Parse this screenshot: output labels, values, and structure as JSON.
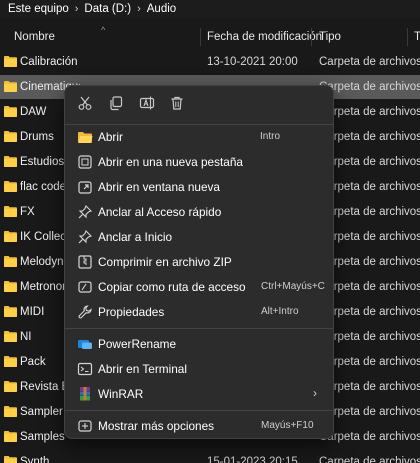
{
  "breadcrumb": {
    "items": [
      "Este equipo",
      "Data (D:)",
      "Audio"
    ]
  },
  "columns": {
    "name": "Nombre",
    "modified": "Fecha de modificación",
    "type": "Tipo",
    "size": "Ta"
  },
  "colors": {
    "folder": "#f3c03c",
    "selected_row": "#5a5a5a",
    "menu_bg": "#2c2c2c"
  },
  "files": [
    {
      "name": "Calibración",
      "date": "13-10-2021 20:00",
      "type": "Carpeta de archivos"
    },
    {
      "name": "Cinematique",
      "date": "",
      "type": "Carpeta de archivos",
      "selected": true
    },
    {
      "name": "DAW",
      "date": "",
      "type": "Carpeta de archivos"
    },
    {
      "name": "Drums",
      "date": "",
      "type": "Carpeta de archivos"
    },
    {
      "name": "Estudios",
      "date": "",
      "type": "Carpeta de archivos"
    },
    {
      "name": "flac codec",
      "date": "",
      "type": "Carpeta de archivos"
    },
    {
      "name": "FX",
      "date": "",
      "type": "Carpeta de archivos"
    },
    {
      "name": "IK Collection",
      "date": "",
      "type": "Carpeta de archivos"
    },
    {
      "name": "Melodyne",
      "date": "",
      "type": "Carpeta de archivos"
    },
    {
      "name": "Metronome",
      "date": "",
      "type": "Carpeta de archivos"
    },
    {
      "name": "MIDI",
      "date": "",
      "type": "Carpeta de archivos"
    },
    {
      "name": "NI",
      "date": "",
      "type": "Carpeta de archivos"
    },
    {
      "name": "Pack",
      "date": "",
      "type": "Carpeta de archivos"
    },
    {
      "name": "Revista Beat",
      "date": "",
      "type": "Carpeta de archivos"
    },
    {
      "name": "Sampler",
      "date": "",
      "type": "Carpeta de archivos"
    },
    {
      "name": "Samples",
      "date": "",
      "type": "Carpeta de archivos"
    },
    {
      "name": "Synth",
      "date": "15-01-2023 20:15",
      "type": "Carpeta de archivos"
    }
  ],
  "quick_actions": [
    {
      "icon": "cut-icon"
    },
    {
      "icon": "copy-icon"
    },
    {
      "icon": "rename-icon"
    },
    {
      "icon": "delete-icon"
    }
  ],
  "menu": {
    "items": [
      {
        "label": "Abrir",
        "shortcut": "Intro",
        "icon": "folder-open-icon"
      },
      {
        "label": "Abrir en una nueva pestaña",
        "shortcut": "",
        "icon": "new-tab-icon"
      },
      {
        "label": "Abrir en ventana nueva",
        "shortcut": "",
        "icon": "new-window-icon"
      },
      {
        "label": "Anclar al Acceso rápido",
        "shortcut": "",
        "icon": "pin-icon"
      },
      {
        "label": "Anclar a Inicio",
        "shortcut": "",
        "icon": "pin-start-icon"
      },
      {
        "label": "Comprimir en archivo ZIP",
        "shortcut": "",
        "icon": "zip-icon"
      },
      {
        "label": "Copiar como ruta de acceso",
        "shortcut": "Ctrl+Mayús+C",
        "icon": "copy-path-icon"
      },
      {
        "label": "Propiedades",
        "shortcut": "Alt+Intro",
        "icon": "wrench-icon"
      },
      {
        "label": "PowerRename",
        "shortcut": "",
        "icon": "powerrename-icon"
      },
      {
        "label": "Abrir en Terminal",
        "shortcut": "",
        "icon": "terminal-icon"
      },
      {
        "label": "WinRAR",
        "shortcut": "",
        "icon": "winrar-icon",
        "submenu": true
      },
      {
        "label": "Mostrar más opciones",
        "shortcut": "Mayús+F10",
        "icon": "more-options-icon"
      }
    ]
  }
}
